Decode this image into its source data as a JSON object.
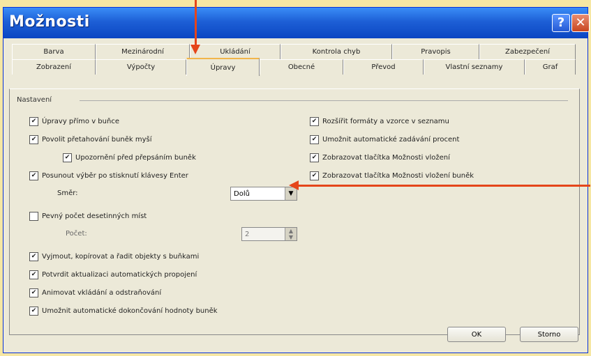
{
  "window": {
    "title": "Možnosti"
  },
  "titlebar": {
    "help_glyph": "?",
    "close_glyph": "✕"
  },
  "tabs": {
    "row1": [
      "Barva",
      "Mezinárodní",
      "Ukládání",
      "Kontrola chyb",
      "Pravopis",
      "Zabezpečení"
    ],
    "row2": [
      "Zobrazení",
      "Výpočty",
      "Úpravy",
      "Obecné",
      "Převod",
      "Vlastní seznamy",
      "Graf"
    ],
    "active": "Úpravy"
  },
  "settings": {
    "group_label": "Nastavení",
    "left": [
      {
        "label": "Úpravy přímo v buňce",
        "checked": true
      },
      {
        "label": "Povolit přetahování buněk myší",
        "checked": true
      },
      {
        "label": "Upozornění před přepsáním buněk",
        "checked": true
      },
      {
        "label": "Posunout výběr po stisknutí klávesy Enter",
        "checked": true
      },
      {
        "label": "Pevný počet desetinných míst",
        "checked": false
      },
      {
        "label": "Vyjmout, kopírovat a řadit objekty s buňkami",
        "checked": true
      },
      {
        "label": "Potvrdit aktualizaci automatických propojení",
        "checked": true
      },
      {
        "label": "Animovat vkládání a odstraňování",
        "checked": true
      },
      {
        "label": "Umožnit automatické dokončování hodnoty buněk",
        "checked": true
      }
    ],
    "right": [
      {
        "label": "Rozšířit formáty a vzorce v seznamu",
        "checked": true
      },
      {
        "label": "Umožnit automatické zadávání procent",
        "checked": true
      },
      {
        "label": "Zobrazovat tlačítka Možnosti vložení",
        "checked": true
      },
      {
        "label": "Zobrazovat tlačítka Možnosti vložení buněk",
        "checked": true
      }
    ],
    "direction": {
      "label": "Směr:",
      "value": "Dolů"
    },
    "count": {
      "label": "Počet:",
      "value": "2"
    },
    "check_glyph": "✔"
  },
  "buttons": {
    "ok": "OK",
    "cancel": "Storno"
  }
}
